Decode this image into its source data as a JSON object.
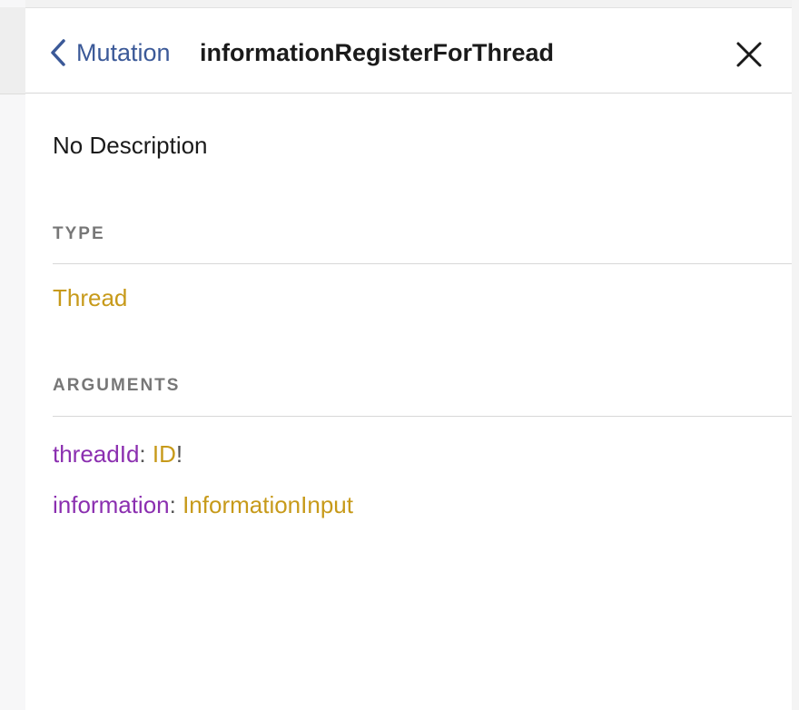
{
  "header": {
    "back_label": "Mutation",
    "title": "informationRegisterForThread"
  },
  "description": "No Description",
  "type_section": {
    "label": "TYPE",
    "value": "Thread"
  },
  "arguments_section": {
    "label": "ARGUMENTS",
    "items": [
      {
        "name": "threadId",
        "colon": ": ",
        "type": "ID",
        "suffix": "!"
      },
      {
        "name": "information",
        "colon": ": ",
        "type": "InformationInput",
        "suffix": ""
      }
    ]
  },
  "colors": {
    "link_blue": "#3b5998",
    "field_purple": "#8b2fb0",
    "type_gold": "#c79a1a",
    "section_gray": "#777777"
  }
}
